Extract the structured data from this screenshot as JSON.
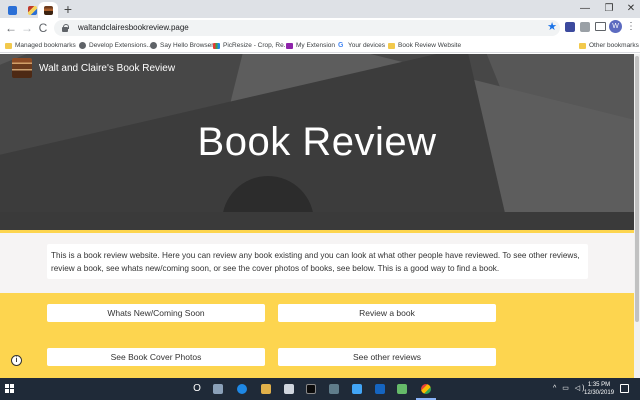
{
  "browser": {
    "url": "waltandclairesbookreview.page",
    "new_tab_symbol": "+",
    "window_controls": {
      "minimize": "—",
      "maximize": "❐",
      "close": "✕"
    },
    "nav": {
      "back": "←",
      "forward": "→",
      "reload": "C"
    },
    "star_symbol": "★",
    "avatar_letter": "W",
    "menu_symbol": "⋮",
    "accent_color": "#1a73e8"
  },
  "bookmarks": [
    {
      "label": "Managed bookmarks",
      "icon": "folder-icon"
    },
    {
      "label": "Develop Extensions...",
      "icon": "globe-icon"
    },
    {
      "label": "Say Hello Browser",
      "icon": "globe-icon"
    },
    {
      "label": "PicResize - Crop, Re...",
      "icon": "picresize-icon"
    },
    {
      "label": "My Extension",
      "icon": "extension-icon"
    },
    {
      "label": "Your devices",
      "icon": "google-icon"
    },
    {
      "label": "Book Review Website",
      "icon": "folder-icon"
    },
    {
      "label": "Other bookmarks",
      "icon": "folder-icon"
    }
  ],
  "site": {
    "brand_name": "Walt and Claire's Book Review",
    "hero_title": "Book Review",
    "intro_text": "This is a book review website. Here you can review any book existing and you can look at what other people have reviewed. To see other reviews, review a book, see whats new/coming soon, or see the cover photos of books, see below. This is a good way to find a book.",
    "buttons": {
      "whats_new": "Whats New/Coming Soon",
      "review": "Review a book",
      "cover_photos": "See Book Cover Photos",
      "other_reviews": "See other reviews"
    },
    "info_symbol": "i",
    "colors": {
      "accent_yellow": "#fdd54f",
      "hero_gray": "#575757",
      "intro_bg": "#f6f4f4"
    }
  },
  "taskbar": {
    "cortana_symbol": "O",
    "time": "1:35 PM",
    "date": "12/30/2019"
  }
}
